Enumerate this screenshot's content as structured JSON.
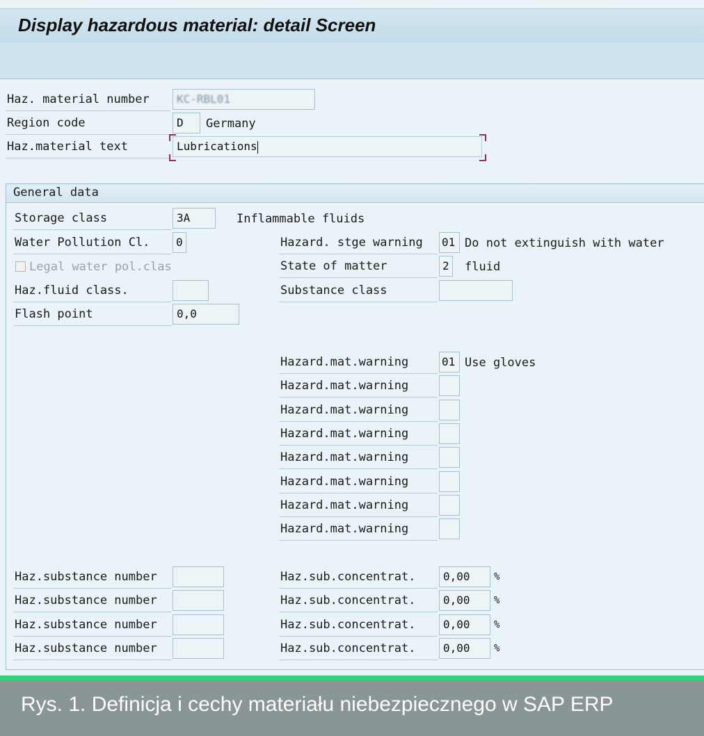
{
  "header": {
    "title": "Display hazardous material: detail Screen"
  },
  "header_fields": {
    "material_number": {
      "label": "Haz. material number",
      "value": "KC-RBL01"
    },
    "region_code": {
      "label": "Region code",
      "value": "D",
      "description": "Germany"
    },
    "material_text": {
      "label": "Haz.material text",
      "value": "Lubrications"
    }
  },
  "general_data": {
    "title": "General data",
    "storage_class": {
      "label": "Storage class",
      "value": "3A",
      "description": "Inflammable fluids"
    },
    "water_pollution": {
      "label": "Water Pollution Cl.",
      "value": "0"
    },
    "legal_water": {
      "label": "Legal water pol.clas",
      "checked": false
    },
    "fluid_class": {
      "label": "Haz.fluid class.",
      "value": ""
    },
    "flash_point": {
      "label": "Flash point",
      "value": "0,0"
    },
    "storage_warning": {
      "label": "Hazard. stge warning",
      "value": "01",
      "description": "Do not extinguish with water"
    },
    "state_of_matter": {
      "label": "State of matter",
      "value": "2",
      "description": "fluid"
    },
    "substance_class": {
      "label": "Substance class",
      "value": ""
    },
    "warnings": [
      {
        "label": "Hazard.mat.warning",
        "value": "01",
        "description": "Use gloves"
      },
      {
        "label": "Hazard.mat.warning",
        "value": "",
        "description": ""
      },
      {
        "label": "Hazard.mat.warning",
        "value": "",
        "description": ""
      },
      {
        "label": "Hazard.mat.warning",
        "value": "",
        "description": ""
      },
      {
        "label": "Hazard.mat.warning",
        "value": "",
        "description": ""
      },
      {
        "label": "Hazard.mat.warning",
        "value": "",
        "description": ""
      },
      {
        "label": "Hazard.mat.warning",
        "value": "",
        "description": ""
      },
      {
        "label": "Hazard.mat.warning",
        "value": "",
        "description": ""
      }
    ],
    "substances": [
      {
        "label": "Haz.substance number",
        "value": "",
        "conc_label": "Haz.sub.concentrat.",
        "conc_value": "0,00",
        "unit": "%"
      },
      {
        "label": "Haz.substance number",
        "value": "",
        "conc_label": "Haz.sub.concentrat.",
        "conc_value": "0,00",
        "unit": "%"
      },
      {
        "label": "Haz.substance number",
        "value": "",
        "conc_label": "Haz.sub.concentrat.",
        "conc_value": "0,00",
        "unit": "%"
      },
      {
        "label": "Haz.substance number",
        "value": "",
        "conc_label": "Haz.sub.concentrat.",
        "conc_value": "0,00",
        "unit": "%"
      }
    ]
  },
  "caption": "Rys. 1. Definicja i cechy materiału niebezpiecznego w SAP ERP"
}
